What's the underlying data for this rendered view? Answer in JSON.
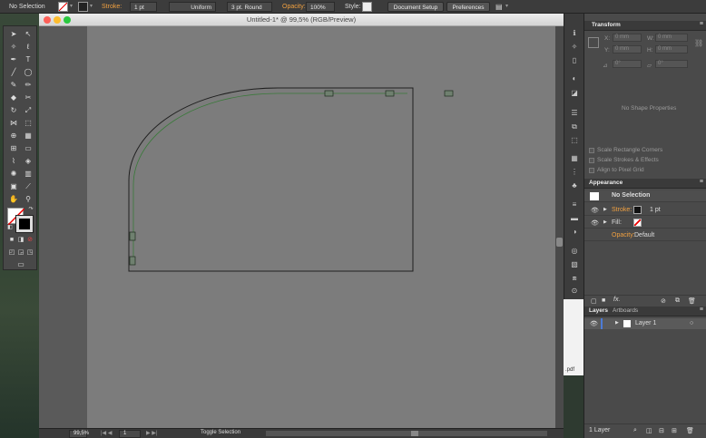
{
  "control_bar": {
    "selection": "No Selection",
    "stroke_label": "Stroke:",
    "stroke_weight": "1 pt",
    "profile": "Uniform",
    "brush": "3 pt. Round",
    "opacity_label": "Opacity:",
    "opacity_value": "100%",
    "style_label": "Style:",
    "document_setup": "Document Setup",
    "preferences": "Preferences"
  },
  "document": {
    "title": "Untitled-1* @ 99,5% (RGB/Preview)",
    "zoom": "99,5%",
    "artboard_nav": "1",
    "status": "Toggle Selection"
  },
  "transform_panel": {
    "title": "Transform",
    "x_label": "X:",
    "y_label": "Y:",
    "w_label": "W:",
    "h_label": "H:",
    "x_value": "0 mm",
    "y_value": "0 mm",
    "w_value": "0 mm",
    "h_value": "0 mm",
    "rotate_value": "0°",
    "shear_value": "0°",
    "no_shape": "No Shape Properties",
    "scale_corners": "Scale Rectangle Corners",
    "scale_strokes": "Scale Strokes & Effects",
    "align_pixel": "Align to Pixel Grid"
  },
  "appearance_panel": {
    "title": "Appearance",
    "no_selection": "No Selection",
    "stroke_label": "Stroke:",
    "stroke_value": "1 pt",
    "fill_label": "Fill:",
    "opacity_label": "Opacity:",
    "opacity_value": "Default"
  },
  "layers_panel": {
    "tab_layers": "Layers",
    "tab_artboards": "Artboards",
    "layer_name": "Layer 1",
    "footer": "1 Layer"
  },
  "finder_peek": {
    "pdf_label": ".pdf"
  },
  "colors": {
    "path_stroke": "#1f1f1f",
    "path_highlight": "#3a7a3a",
    "layer_color": "#4d7bd6",
    "accent": "#f0a040"
  }
}
